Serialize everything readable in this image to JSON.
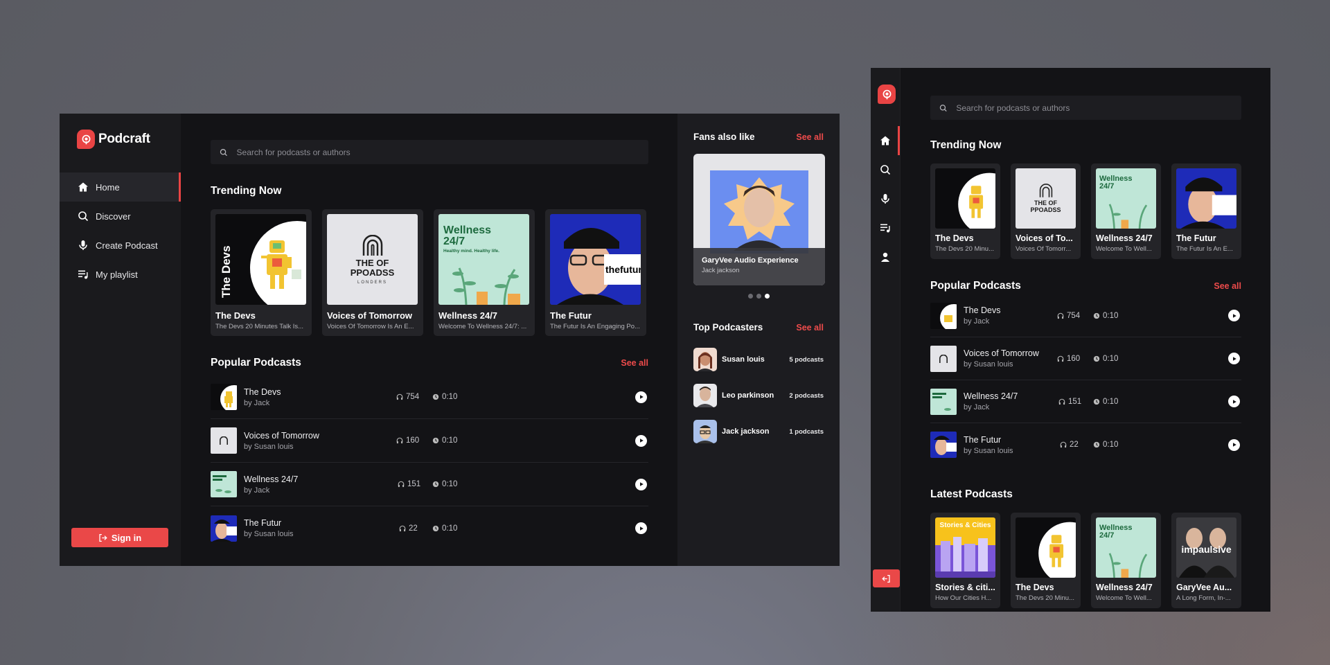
{
  "app": {
    "name": "Podcraft"
  },
  "colors": {
    "accent": "#ea4848",
    "background": "#131316",
    "sidebar": "#1a1a1d",
    "card": "#242428"
  },
  "nav": [
    {
      "label": "Home",
      "icon": "home-icon",
      "active": true
    },
    {
      "label": "Discover",
      "icon": "search-icon"
    },
    {
      "label": "Create Podcast",
      "icon": "microphone-icon"
    },
    {
      "label": "My playlist",
      "icon": "playlist-icon"
    }
  ],
  "compact_nav_extra": {
    "icon": "user-icon"
  },
  "auth": {
    "signin_label": "Sign in"
  },
  "search": {
    "placeholder": "Search for podcasts or authors"
  },
  "sections": {
    "trending": "Trending Now",
    "popular": "Popular Podcasts",
    "latest": "Latest Podcasts",
    "fans": "Fans also like",
    "top_podcasters": "Top Podcasters",
    "see_all": "See all"
  },
  "trending_desktop": [
    {
      "title": "The Devs",
      "subtitle": "The Devs 20 Minutes Talk Is..."
    },
    {
      "title": "Voices of Tomorrow",
      "subtitle": "Voices Of Tomorrow Is An E..."
    },
    {
      "title": "Wellness 24/7",
      "subtitle": "Welcome To Wellness 24/7: ..."
    },
    {
      "title": "The Futur",
      "subtitle": "The Futur Is An Engaging Po..."
    }
  ],
  "trending_compact": [
    {
      "title": "The Devs",
      "subtitle": "The Devs 20 Minu..."
    },
    {
      "title": "Voices of To...",
      "subtitle": "Voices Of Tomorr..."
    },
    {
      "title": "Wellness 24/7",
      "subtitle": "Welcome To Well..."
    },
    {
      "title": "The Futur",
      "subtitle": "The Futur Is An E..."
    }
  ],
  "popular": [
    {
      "name": "The Devs",
      "by": "by Jack",
      "listens": "754",
      "duration": "0:10"
    },
    {
      "name": "Voices of Tomorrow",
      "by": "by Susan louis",
      "listens": "160",
      "duration": "0:10"
    },
    {
      "name": "Wellness 24/7",
      "by": "by Jack",
      "listens": "151",
      "duration": "0:10"
    },
    {
      "name": "The Futur",
      "by": "by Susan louis",
      "listens": "22",
      "duration": "0:10"
    }
  ],
  "latest": [
    {
      "title": "Stories & citi...",
      "subtitle": "How Our Cities H..."
    },
    {
      "title": "The Devs",
      "subtitle": "The Devs 20 Minu..."
    },
    {
      "title": "Wellness 24/7",
      "subtitle": "Welcome To Well..."
    },
    {
      "title": "GaryVee Au...",
      "subtitle": "A Long Form, In-..."
    }
  ],
  "fans": {
    "title": "GaryVee Audio Experience",
    "author": "Jack jackson",
    "slide_count": 3,
    "active_slide": 3
  },
  "top_podcasters": [
    {
      "name": "Susan louis",
      "count": "5 podcasts"
    },
    {
      "name": "Leo parkinson",
      "count": "2 podcasts"
    },
    {
      "name": "Jack jackson",
      "count": "1 podcasts"
    }
  ],
  "art_text": {
    "devs_spine": "The Devs",
    "voices_logo": "THE OF PPOADSS",
    "voices_small": "LONDERS",
    "wellness_title": "Wellness 24/7",
    "wellness_tag": "Healthy mind. Healthy life.",
    "futur_brand": "thefutur",
    "stories_title": "Stories & Cities",
    "impaulsive": "impaulsive"
  }
}
